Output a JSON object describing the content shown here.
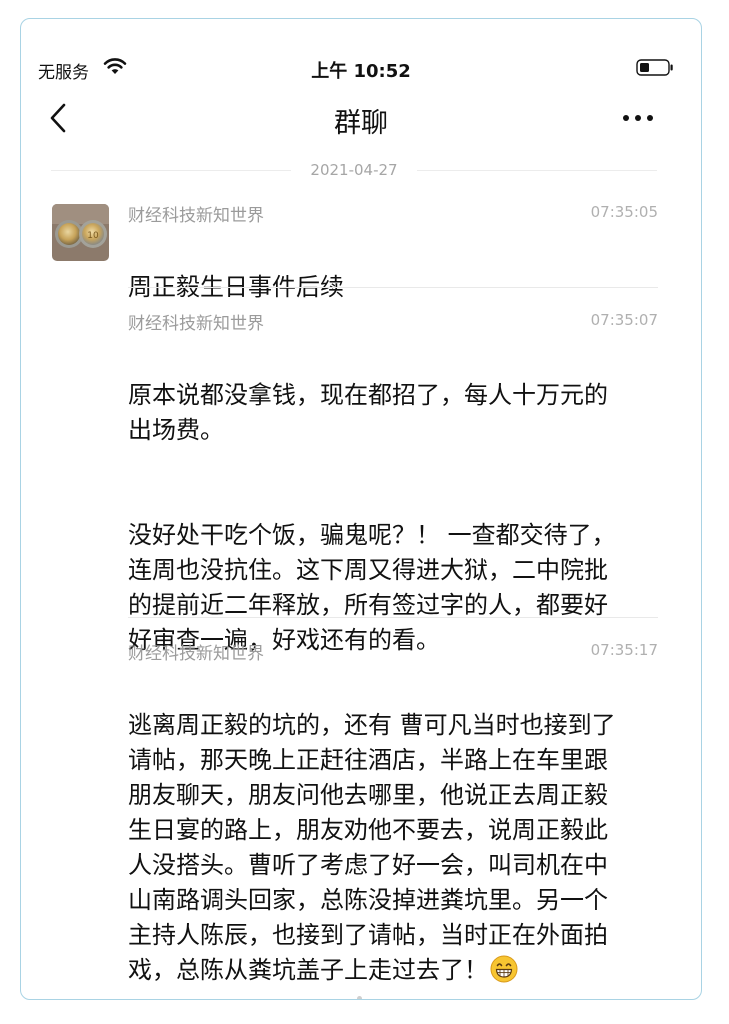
{
  "status_bar": {
    "carrier": "无服务",
    "time": "上午 10:52"
  },
  "nav": {
    "title": "群聊",
    "back_icon": "chevron-left-icon",
    "more_icon": "ellipsis-icon"
  },
  "date_divider": "2021-04-27",
  "messages": [
    {
      "sender": "财经科技新知世界",
      "time": "07:35:05",
      "paragraphs": [
        "周正毅生日事件后续"
      ]
    },
    {
      "sender": "财经科技新知世界",
      "time": "07:35:07",
      "paragraphs": [
        "原本说都没拿钱，现在都招了，每人十万元的\n出场费。",
        "没好处干吃个饭，骗鬼呢？！ 一查都交待了，\n连周也没抗住。这下周又得进大狱，二中院批\n的提前近二年释放，所有签过字的人，都要好\n好审查一遍，好戏还有的看。"
      ]
    },
    {
      "sender": "财经科技新知世界",
      "time": "07:35:17",
      "paragraphs": [
        "逃离周正毅的坑的，还有 曹可凡当时也接到了\n请帖，那天晚上正赶往酒店，半路上在车里跟\n朋友聊天，朋友问他去哪里，他说正去周正毅\n生日宴的路上，朋友劝他不要去，说周正毅此\n人没搭头。曹听了考虑了好一会，叫司机在中\n山南路调头回家，总陈没掉进粪坑里。另一个\n主持人陈辰，也接到了请帖，当时正在外面拍\n戏，总陈从粪坑盖子上走过去了！"
      ]
    }
  ],
  "colors": {
    "card_border": "#a9d3e4",
    "sender_text": "#9b9b9b",
    "time_text": "#b0b0b0"
  }
}
